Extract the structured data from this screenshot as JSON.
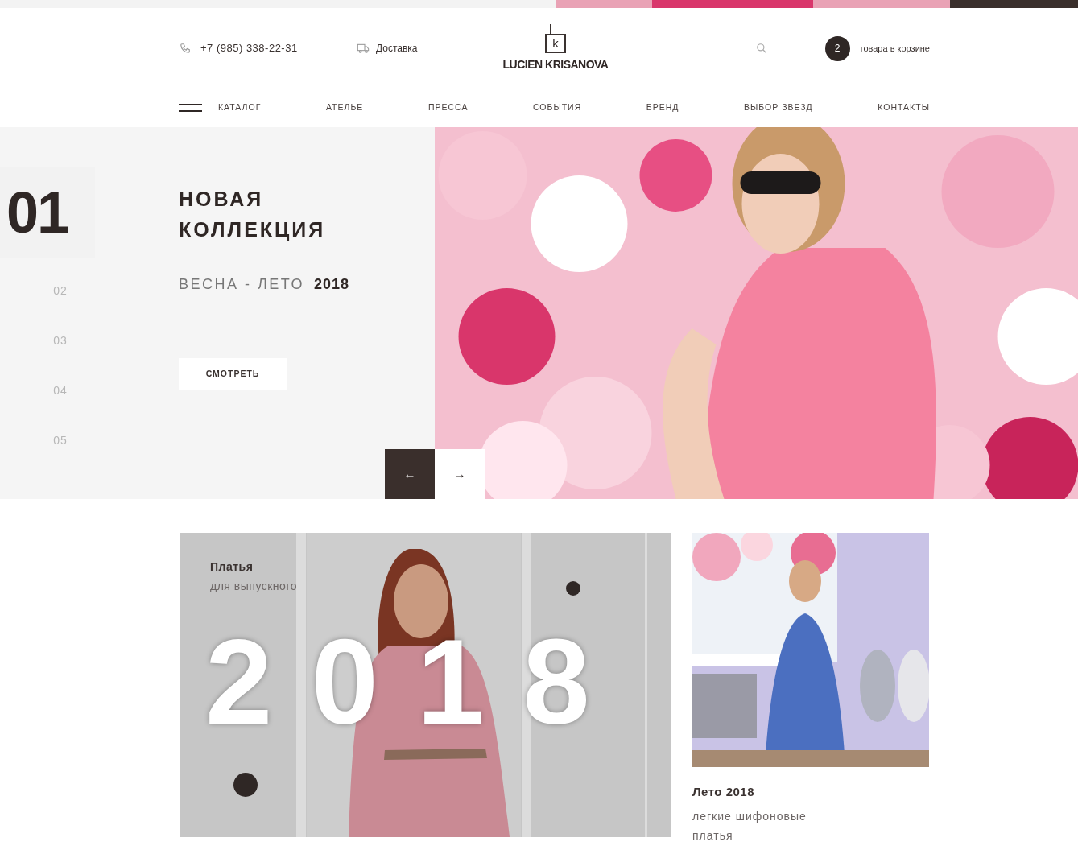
{
  "header": {
    "phone": "+7 (985) 338-22-31",
    "delivery": "Доставка",
    "logo": {
      "mark": "k",
      "name": "LUCIEN KRISANOVA"
    },
    "cart": {
      "count": "2",
      "label": "товара в корзине"
    }
  },
  "nav": [
    {
      "label": "КАТАЛОГ",
      "kind": "menu"
    },
    {
      "label": "АТЕЛЬЕ",
      "kind": "link"
    },
    {
      "label": "ПРЕССА",
      "kind": "link"
    },
    {
      "label": "СОБЫТИЯ",
      "kind": "link"
    },
    {
      "label": "БРЕНД",
      "kind": "link"
    },
    {
      "label": "ВЫБОР ЗВЕЗД",
      "kind": "link"
    },
    {
      "label": "КОНТАКТЫ",
      "kind": "link"
    }
  ],
  "hero": {
    "title": "НОВАЯ КОЛЛЕКЦИЯ",
    "season": "ВЕСНА - ЛЕТО",
    "year": "2018",
    "button": "СМОТРЕТЬ",
    "slides": [
      {
        "label": "01",
        "selected": true
      },
      {
        "label": "02",
        "selected": false
      },
      {
        "label": "03",
        "selected": false
      },
      {
        "label": "04",
        "selected": false
      },
      {
        "label": "05",
        "selected": false
      }
    ],
    "arrows": [
      {
        "symbol": "←",
        "selected": true
      },
      {
        "symbol": "→",
        "selected": false
      }
    ]
  },
  "cards": [
    {
      "kind": "wide",
      "title": "Платья",
      "subtitle": "для выпускного",
      "overlay": "2018"
    },
    {
      "kind": "small",
      "title": "Лето 2018",
      "subtitle": "легкие шифоновые платья"
    }
  ]
}
